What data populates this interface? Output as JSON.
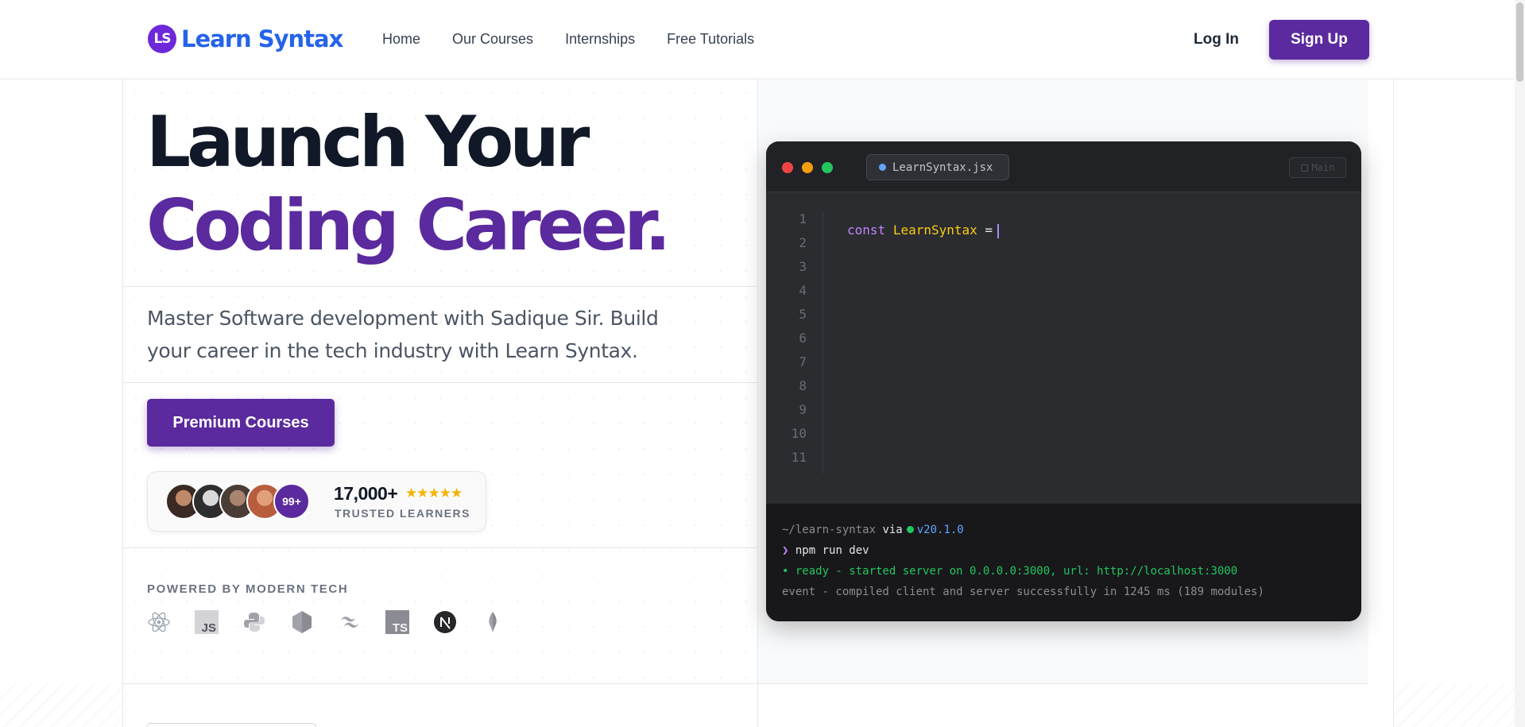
{
  "nav": {
    "logo_mark": "LS",
    "logo_text": "Learn Syntax",
    "links": [
      "Home",
      "Our Courses",
      "Internships",
      "Free Tutorials"
    ],
    "login": "Log In",
    "signup": "Sign Up"
  },
  "hero": {
    "headline_line1": "Launch Your",
    "headline_line2": "Coding Career.",
    "subtitle": "Master Software development with Sadique Sir. Build your career in the tech industry with Learn Syntax.",
    "cta": "Premium Courses",
    "trust": {
      "more_badge": "99+",
      "count": "17,000+",
      "rating_stars": 5,
      "stars": "★★★★★",
      "label": "TRUSTED LEARNERS"
    },
    "powered_by": "POWERED BY MODERN TECH",
    "tech_icons": [
      "react-icon",
      "javascript-icon",
      "python-icon",
      "nodejs-icon",
      "tailwind-icon",
      "typescript-icon",
      "nextjs-icon",
      "mongodb-icon"
    ]
  },
  "editor": {
    "filename": "LearnSyntax.jsx",
    "branch": "Main",
    "line_numbers": [
      "1",
      "2",
      "3",
      "4",
      "5",
      "6",
      "7",
      "8",
      "9",
      "10",
      "11"
    ],
    "code_keyword": "const",
    "code_identifier": "LearnSyntax",
    "code_operator": " =",
    "terminal": {
      "path": "~/learn-syntax",
      "via": " via",
      "node_version": "v20.1.0",
      "prompt": "❯",
      "command": " npm run dev",
      "ready_line": "• ready - started server on 0.0.0.0:3000, url: http://localhost:3000",
      "event_line": "event - compiled client and server successfully in 1245 ms (189 modules)"
    }
  },
  "colors": {
    "brand_purple": "#5b2a9e",
    "logo_blue": "#2563eb",
    "star_gold": "#f5b400",
    "terminal_green": "#22c55e"
  }
}
